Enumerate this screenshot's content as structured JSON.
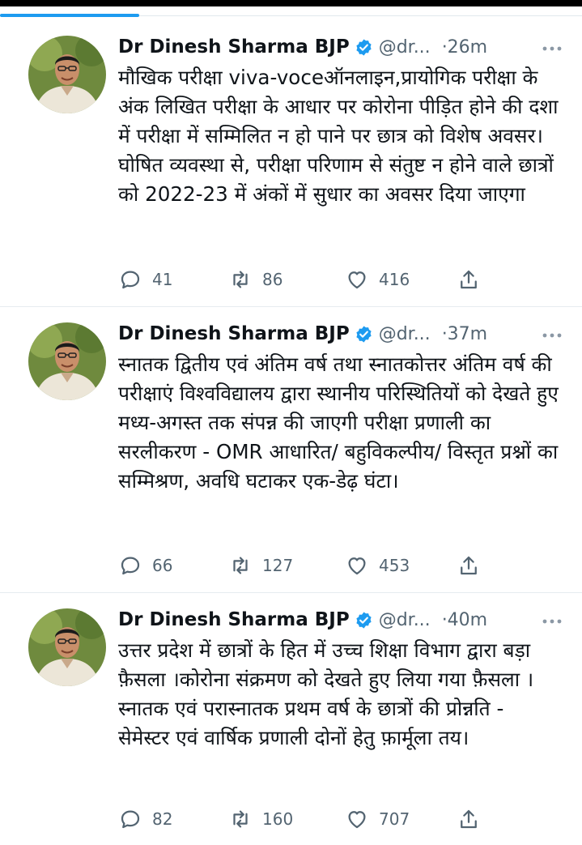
{
  "author": {
    "name": "Dr Dinesh Sharma BJP",
    "handle": "@dr...",
    "verified_color": "#1d9bf0"
  },
  "tweets": [
    {
      "time": "·26m",
      "text": "मौखिक परीक्षा viva-voceऑनलाइन,प्रायोगिक परीक्षा के अंक लिखित परीक्षा के आधार पर कोरोना पीड़ित होने की दशा में  परीक्षा में सम्मिलित न हो पाने पर छात्र को विशेष अवसर।घोषित व्यवस्था से, परीक्षा परिणाम से संतुष्ट न होने वाले छात्रों को 2022-23 में अंकों में सुधार का अवसर दिया जाएगा",
      "replies": "41",
      "retweets": "86",
      "likes": "416"
    },
    {
      "time": "·37m",
      "text": "स्नातक द्वितीय एवं अंतिम वर्ष तथा स्नातकोत्तर अंतिम वर्ष की परीक्षाएं विश्वविद्यालय द्वारा स्थानीय परिस्थितियों को देखते हुए मध्य-अगस्त तक संपन्न की जाएगी परीक्षा प्रणाली का सरलीकरण - OMR आधारित/ बहुविकल्पीय/ विस्तृत प्रश्नों का सम्मिश्रण, अवधि घटाकर एक-डेढ़ घंटा।",
      "replies": "66",
      "retweets": "127",
      "likes": "453"
    },
    {
      "time": "·40m",
      "text": "उत्तर प्रदेश में छात्रों के हित में उच्च शिक्षा विभाग द्वारा बड़ा फ़ैसला ।कोरोना संक्रमण को देखते हुए लिया गया फ़ैसला ।स्नातक एवं परास्नातक प्रथम वर्ष के छात्रों की प्रोन्नति - सेमेस्टर एवं वार्षिक प्रणाली दोनों हेतु फ़ार्मूला तय।",
      "replies": "82",
      "retweets": "160",
      "likes": "707"
    }
  ]
}
